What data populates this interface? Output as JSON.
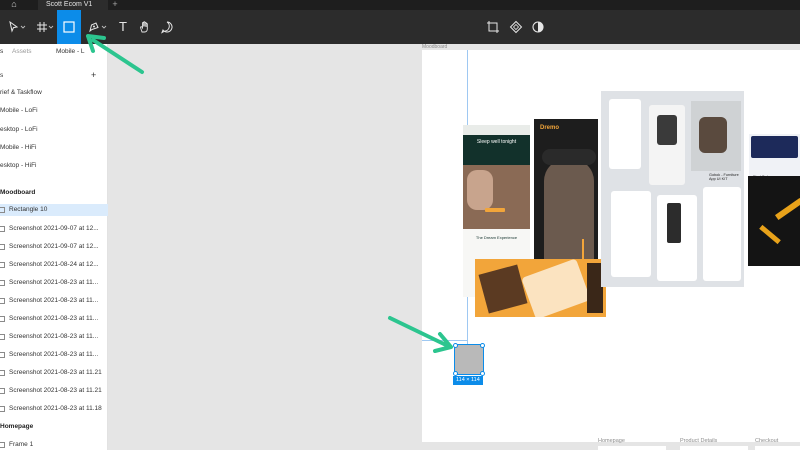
{
  "window": {
    "file_title": "Scott Ecom V1",
    "new_tab": "+"
  },
  "icons": {
    "home": "home-icon",
    "move": "move-tool-icon",
    "frame": "frame-tool-icon",
    "rectangle": "rectangle-tool-icon",
    "pen": "pen-tool-icon",
    "text": "text-tool-icon",
    "hand": "hand-tool-icon",
    "comment": "comment-tool-icon",
    "component": "component-icon",
    "theme": "contrast-icon"
  },
  "colors": {
    "accent": "#0c8ce9",
    "annotation_arrow": "#2cc58f",
    "toolbar": "#2c2c2c",
    "tabbar": "#1e1e1e"
  },
  "toolbar": {
    "text_tool": "T"
  },
  "left_panel": {
    "tabs": {
      "layers": "s",
      "assets": "Assets",
      "page": "Mobile - L"
    },
    "add_page": "+",
    "pages": [
      "rief & Taskflow",
      "Mobile - LoFi",
      "esktop - LoFi",
      "Mobile - HiFi",
      "esktop - HiFi"
    ],
    "section_moodboard": "Moodboard",
    "layers": [
      "Rectangle 10",
      "Screenshot 2021-09-07 at 12...",
      "Screenshot 2021-09-07 at 12...",
      "Screenshot 2021-08-24 at 12...",
      "Screenshot 2021-08-23 at 11...",
      "Screenshot 2021-08-23 at 11...",
      "Screenshot 2021-08-23 at 11...",
      "Screenshot 2021-08-23 at 11...",
      "Screenshot 2021-08-23 at 11...",
      "Screenshot 2021-08-23 at 11.21",
      "Screenshot 2021-08-23 at 11.21",
      "Screenshot 2021-08-23 at 11.18"
    ],
    "section_homepage": "Homepage",
    "homepage_layers": [
      "Frame 1"
    ]
  },
  "canvas": {
    "artboard_label": "Moodboard",
    "selection_size": "114 × 114",
    "mockup_texts": {
      "s1_headline": "Sleep well tonight",
      "s1_sub": "The Dream Experience",
      "s2_brand": "Dremo",
      "s4_title": "Gobok - Furniture App UI KIT",
      "s5_title": "Find Sales"
    },
    "bottom_frames": [
      "Homepage",
      "Product Details",
      "Checkout"
    ]
  }
}
